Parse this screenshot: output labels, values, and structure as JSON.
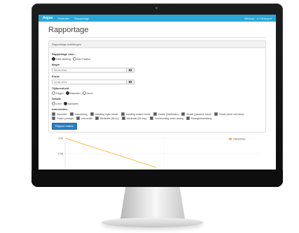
{
  "app": {
    "brand": "Argus",
    "nav": [
      "Patiënten",
      "Rapportage"
    ],
    "user": "Welkom · U Clinicus ▾"
  },
  "page": {
    "title": "Rapportage"
  },
  "panel": {
    "heading": "Rapportage instellingen",
    "report_for": {
      "label": "Rapportage voor...",
      "options": [
        {
          "label": "Hele afdeling",
          "selected": true
        },
        {
          "label": "Een Patiënt",
          "selected": false
        }
      ]
    },
    "begin": {
      "label": "Begin",
      "value": "28-05-2014"
    },
    "end": {
      "label": "Einde",
      "value": "12-06-2014"
    },
    "time_unit": {
      "label": "Tijdseenheid",
      "options": [
        {
          "label": "Dagen",
          "selected": false
        },
        {
          "label": "Maanden",
          "selected": true
        },
        {
          "label": "Jaren",
          "selected": false
        }
      ]
    },
    "details": {
      "label": "Details",
      "options": [
        {
          "label": "Uren",
          "selected": false
        },
        {
          "label": "Aantallen",
          "selected": true
        }
      ]
    },
    "interventions": {
      "label": "Interventies",
      "items": [
        "Separatie",
        "Afzondering",
        "Insluiting eigen kamer",
        "Insluiting andere ruimte",
        "Fixatie (vastbinden)",
        "Fixatie (passieve band)",
        "Fixatie (short met band)",
        "Fixatie (overige)",
        "Interventie",
        "Medicatie (IM inj.)",
        "Medicatie (IM orig.)",
        "Vochtvoeding onder dwang",
        "Dwangbehandeling"
      ]
    },
    "submit_label": "Rapport maken"
  },
  "colors": {
    "navbar": "#29a8d6",
    "series": "#f5a623",
    "button": "#2a7fc1"
  },
  "chart_data": {
    "type": "line",
    "series": [
      {
        "name": "Interventies",
        "x": [
          0,
          1
        ],
        "values": [
          3.0,
          2.0
        ]
      }
    ],
    "ytick_labels": [
      "3.00",
      "2.50",
      "2.00"
    ],
    "ylim": [
      2.0,
      3.0
    ],
    "legend": "top-right",
    "grid": true
  }
}
